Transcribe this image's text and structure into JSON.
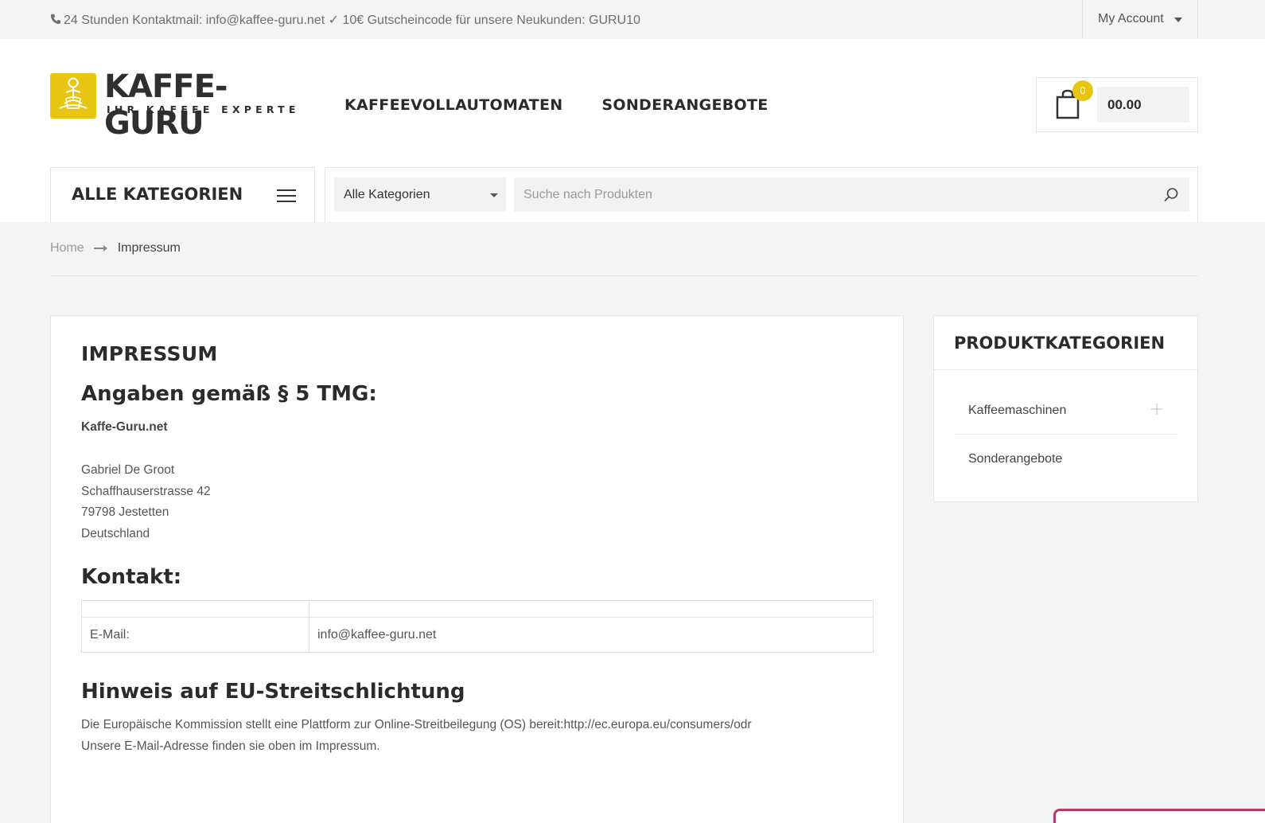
{
  "topbar": {
    "contact_text": "24 Stunden Kontaktmail: info@kaffee-guru.net ✓ 10€ Gutscheincode für unsere Neukunden: GURU10",
    "account_label": "My Account"
  },
  "logo": {
    "name": "KAFFE-GURU",
    "tagline": "IHR KAFFEE EXPERTE",
    "color": "#e8c512"
  },
  "nav": {
    "items": [
      "KAFFEEVOLLAUTOMATEN",
      "SONDERANGEBOTE"
    ]
  },
  "cart": {
    "count": "0",
    "total": "00.00"
  },
  "categories": {
    "label": "ALLE KATEGORIEN"
  },
  "search": {
    "select_value": "Alle Kategorien",
    "placeholder": "Suche nach Produkten"
  },
  "breadcrumb": {
    "home": "Home",
    "current": "Impressum"
  },
  "page": {
    "title": "IMPRESSUM",
    "section1": "Angaben gemäß § 5 TMG:",
    "company": "Kaffe-Guru.net",
    "address": [
      "Gabriel De Groot",
      "Schaffhauserstrasse 42",
      "79798 Jestetten",
      "Deutschland"
    ],
    "section2": "Kontakt:",
    "contact_rows": [
      {
        "label": "",
        "value": ""
      },
      {
        "label": "E-Mail:",
        "value": "info@kaffee-guru.net"
      }
    ],
    "section3": "Hinweis auf EU-Streitschlichtung",
    "eu_text": [
      "Die Europäische Kommission stellt eine Plattform zur Online-Streitbeilegung (OS) bereit:http://ec.europa.eu/consumers/odr",
      "Unsere E-Mail-Adresse finden sie oben im Impressum."
    ]
  },
  "sidebar": {
    "title": "PRODUKTKATEGORIEN",
    "items": [
      "Kaffeemaschinen",
      "Sonderangebote"
    ]
  }
}
